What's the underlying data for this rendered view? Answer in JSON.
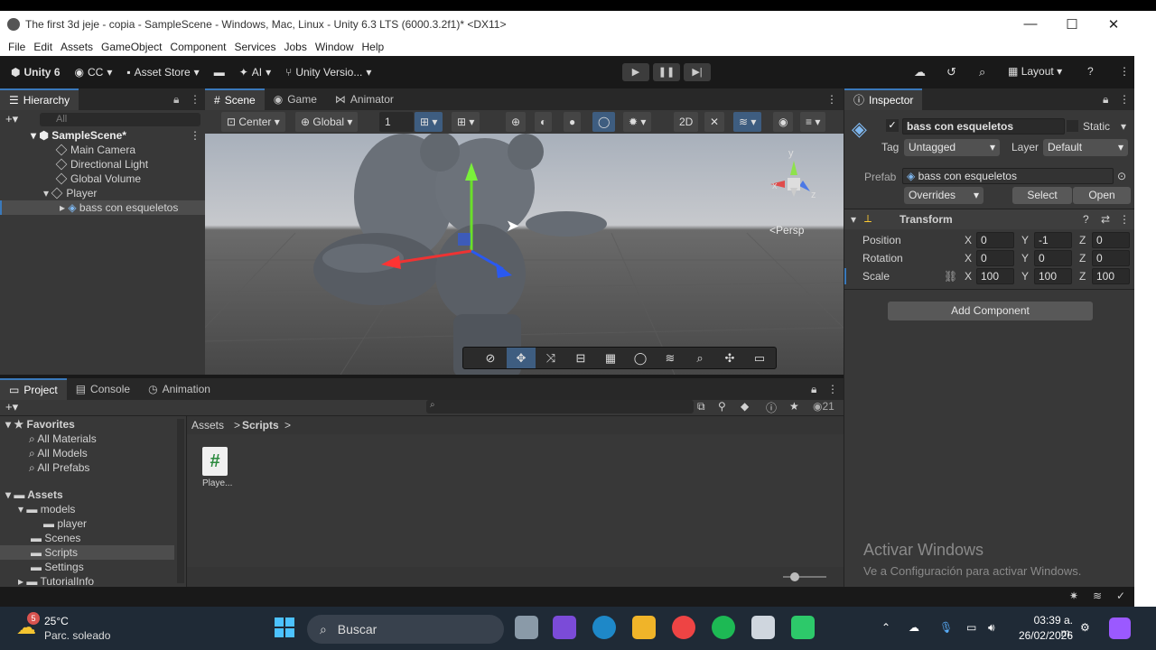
{
  "window": {
    "title": "The first 3d jeje - copia - SampleScene - Windows, Mac, Linux - Unity 6.3 LTS (6000.3.2f1)* <DX11>",
    "minimize": "—",
    "maximize": "☐",
    "close": "✕"
  },
  "menu": [
    "File",
    "Edit",
    "Assets",
    "GameObject",
    "Component",
    "Services",
    "Jobs",
    "Window",
    "Help"
  ],
  "toolbar": {
    "unity": "Unity 6",
    "account": "CC",
    "asset_store": "Asset Store",
    "ai": "AI",
    "version_control": "Unity Versio...",
    "layout": "Layout"
  },
  "hierarchy": {
    "tab": "Hierarchy",
    "search_placeholder": "All",
    "scene": "SampleScene*",
    "items": [
      {
        "label": "Main Camera"
      },
      {
        "label": "Directional Light"
      },
      {
        "label": "Global Volume"
      },
      {
        "label": "Player"
      },
      {
        "label": "bass con esqueletos"
      }
    ]
  },
  "scene_tabs": [
    "Scene",
    "Game",
    "Animator"
  ],
  "scene_toolbar": {
    "pivot": "Center",
    "space": "Global",
    "snap": "1"
  },
  "scene_view": {
    "projection": "Persp",
    "gizmo_y": "y",
    "gizmo_x": "x",
    "gizmo_z": "z"
  },
  "inspector": {
    "tab": "Inspector",
    "object_name": "bass con esqueletos",
    "static_label": "Static",
    "tag_label": "Tag",
    "tag_value": "Untagged",
    "layer_label": "Layer",
    "layer_value": "Default",
    "prefab_label": "Prefab",
    "prefab_value": "bass con esqueletos",
    "overrides": "Overrides",
    "select": "Select",
    "open": "Open",
    "transform_title": "Transform",
    "position_label": "Position",
    "rotation_label": "Rotation",
    "scale_label": "Scale",
    "axis_x": "X",
    "axis_y": "Y",
    "axis_z": "Z",
    "position": {
      "x": "0",
      "y": "-1",
      "z": "0"
    },
    "rotation": {
      "x": "0",
      "y": "0",
      "z": "0"
    },
    "scale": {
      "x": "100",
      "y": "100",
      "z": "100"
    },
    "add_component": "Add Component",
    "watermark_title": "Activar Windows",
    "watermark_sub": "Ve a Configuración para activar Windows."
  },
  "project": {
    "tabs": [
      "Project",
      "Console",
      "Animation"
    ],
    "hidden_count": "21",
    "favorites": "Favorites",
    "favorite_items": [
      "All Materials",
      "All Models",
      "All Prefabs"
    ],
    "assets": "Assets",
    "asset_tree": [
      "models",
      "player",
      "Scenes",
      "Scripts",
      "Settings",
      "TutorialInfo"
    ],
    "breadcrumb_root": "Assets",
    "breadcrumb_current": "Scripts",
    "files": [
      {
        "label": "Playe...",
        "icon": "#"
      }
    ]
  },
  "taskbar": {
    "weather_temp": "25°C",
    "weather_desc": "Parc. soleado",
    "weather_badge": "5",
    "search": "Buscar",
    "time": "03:39 a. m.",
    "date": "26/02/2026"
  },
  "colors": {
    "accent": "#3a79bb",
    "panel": "#383838",
    "header": "#282828",
    "toolbar": "#191919"
  }
}
